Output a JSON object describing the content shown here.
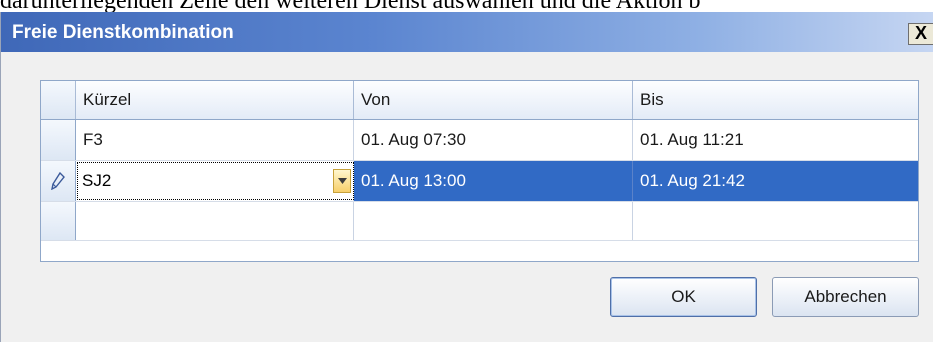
{
  "background_text": "darunterliegenden Zeile den weiteren Dienst auswählen und die Aktion b",
  "dialog": {
    "title": "Freie Dienstkombination",
    "close_label": "X"
  },
  "grid": {
    "columns": [
      "Kürzel",
      "Von",
      "Bis"
    ],
    "rows": [
      {
        "kuerzel": "F3",
        "von": "01. Aug 07:30",
        "bis": "01. Aug 11:21"
      },
      {
        "kuerzel": "SJ2",
        "von": "01. Aug 13:00",
        "bis": "01. Aug 21:42"
      }
    ],
    "selected_row": 1,
    "editing_row_icon": "pencil-icon"
  },
  "buttons": {
    "ok": "OK",
    "cancel": "Abbrechen"
  },
  "colors": {
    "selection": "#316ac5",
    "titlebar_start": "#3f68b8",
    "dropdown_accent": "#f7cf6a"
  }
}
